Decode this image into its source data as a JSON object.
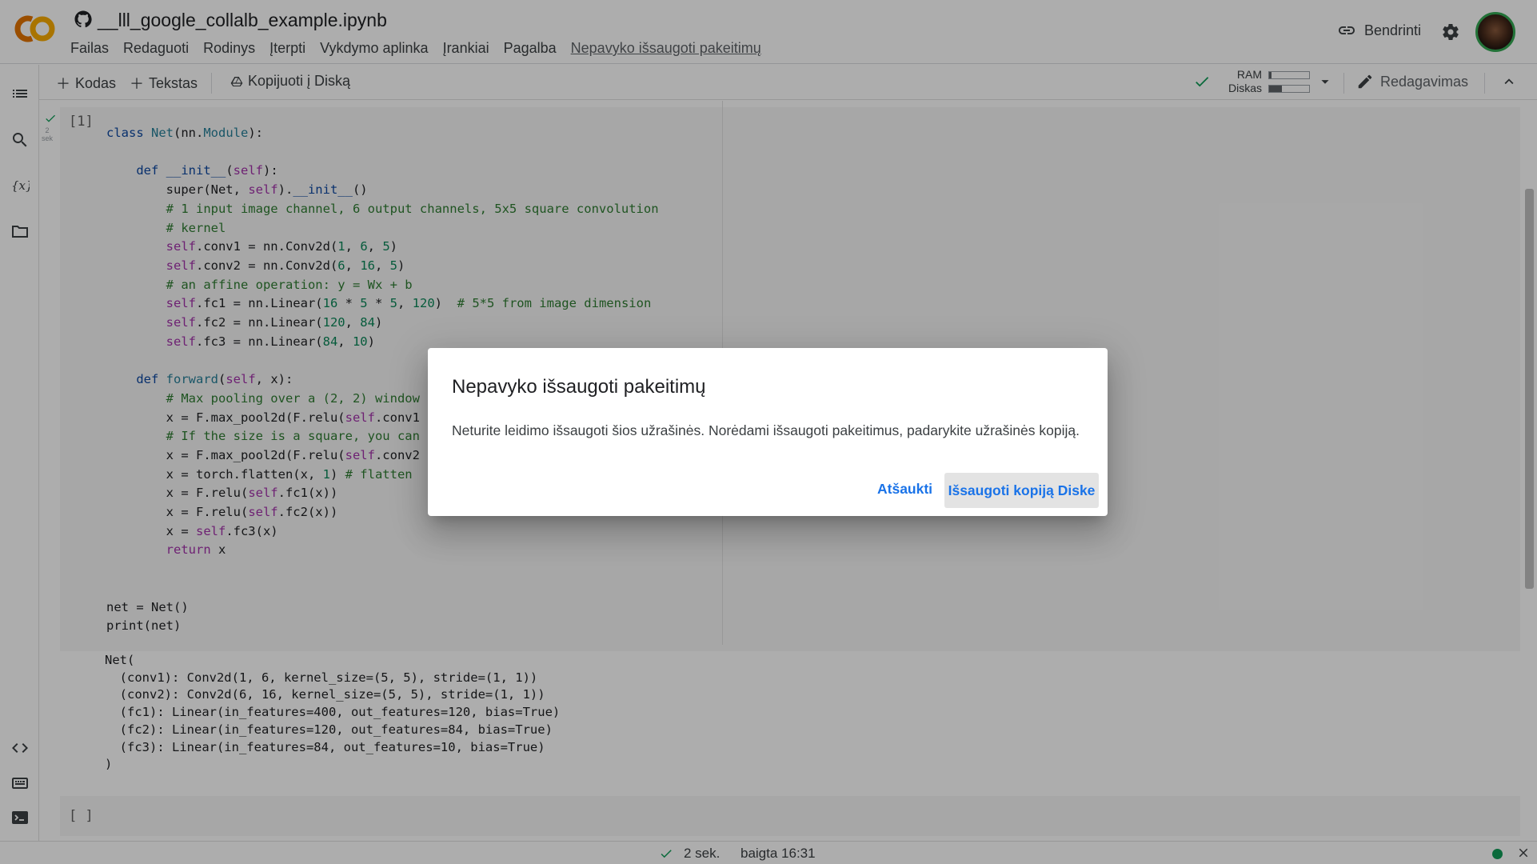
{
  "header": {
    "notebook_title": "__lll_google_collalb_example.ipynb",
    "menu": [
      "Failas",
      "Redaguoti",
      "Rodinys",
      "Įterpti",
      "Vykdymo aplinka",
      "Įrankiai",
      "Pagalba"
    ],
    "unsaved_link": "Nepavyko išsaugoti pakeitimų",
    "share_label": "Bendrinti"
  },
  "toolbar": {
    "code_label": "Kodas",
    "text_label": "Tekstas",
    "copy_label": "Kopijuoti į Diską",
    "ram_label": "RAM",
    "disk_label": "Diskas",
    "ram_usage": 0.06,
    "disk_usage": 0.32,
    "edit_label": "Redagavimas"
  },
  "cell": {
    "exec_count": "[1]",
    "run_time_value": "2",
    "run_time_unit": "sek"
  },
  "output": {
    "lines": [
      "Net(",
      "  (conv1): Conv2d(1, 6, kernel_size=(5, 5), stride=(1, 1))",
      "  (conv2): Conv2d(6, 16, kernel_size=(5, 5), stride=(1, 1))",
      "  (fc1): Linear(in_features=400, out_features=120, bias=True)",
      "  (fc2): Linear(in_features=120, out_features=84, bias=True)",
      "  (fc3): Linear(in_features=84, out_features=10, bias=True)",
      ")"
    ]
  },
  "empty_cell": {
    "exec_count": "[ ]"
  },
  "status": {
    "time": "2 sek.",
    "done": "baigta 16:31"
  },
  "dialog": {
    "title": "Nepavyko išsaugoti pakeitimų",
    "body": "Neturite leidimo išsaugoti šios užrašinės. Norėdami išsaugoti pakeitimus, padarykite užrašinės kopiją.",
    "cancel_label": "Atšaukti",
    "save_copy_label": "Išsaugoti kopiją Diske"
  },
  "colors": {
    "accent": "#1a73e8",
    "success": "#0f9d58",
    "logo_orange": "#f9ab00",
    "logo_dark_orange": "#e37400"
  }
}
